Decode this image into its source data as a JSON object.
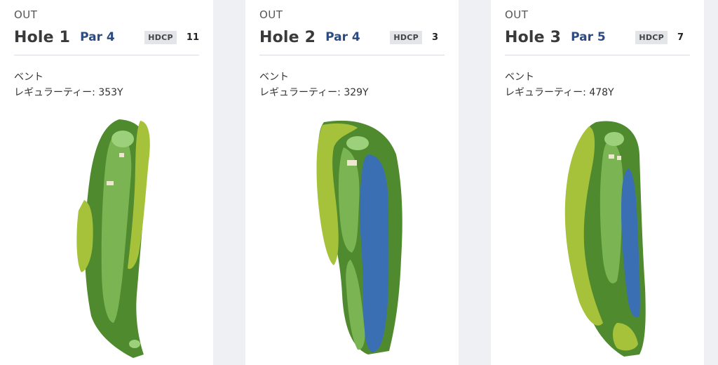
{
  "holes": [
    {
      "section": "OUT",
      "title": "Hole 1",
      "par": "Par 4",
      "hdcp_label": "HDCP",
      "hdcp": "11",
      "green": "ベント",
      "tee": "レギュラーティー: 353Y"
    },
    {
      "section": "OUT",
      "title": "Hole 2",
      "par": "Par 4",
      "hdcp_label": "HDCP",
      "hdcp": "3",
      "green": "ベント",
      "tee": "レギュラーティー: 329Y"
    },
    {
      "section": "OUT",
      "title": "Hole 3",
      "par": "Par 5",
      "hdcp_label": "HDCP",
      "hdcp": "7",
      "green": "ベント",
      "tee": "レギュラーティー: 478Y"
    }
  ],
  "colors": {
    "rough": "#4f8a2e",
    "fairway": "#7bb553",
    "green_surface": "#9cd07a",
    "water": "#3b6fb3",
    "bunker": "#efe6cf",
    "trees": "#a6c23a",
    "par_text": "#2c4b80"
  }
}
